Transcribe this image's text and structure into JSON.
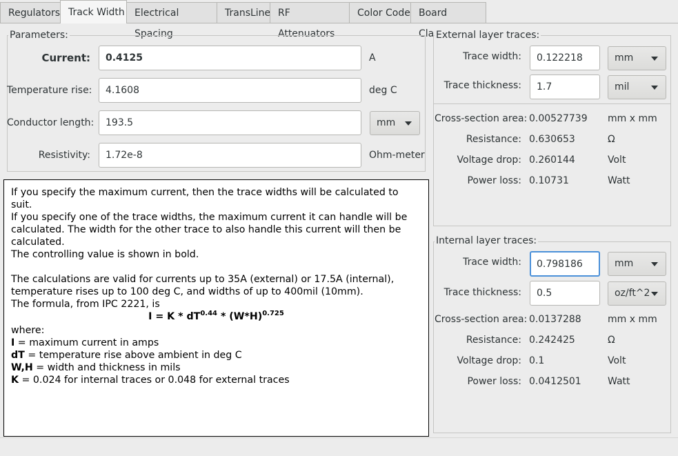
{
  "tabs": [
    "Regulators",
    "Track Width",
    "Electrical Spacing",
    "TransLine",
    "RF Attenuators",
    "Color Code",
    "Board Classes"
  ],
  "parameters": {
    "title": "Parameters:",
    "current": {
      "label": "Current:",
      "value": "0.4125",
      "unit": "A"
    },
    "temperature_rise": {
      "label": "Temperature rise:",
      "value": "4.1608",
      "unit": "deg C"
    },
    "conductor_length": {
      "label": "Conductor length:",
      "value": "193.5",
      "unit": "mm"
    },
    "resistivity": {
      "label": "Resistivity:",
      "value": "1.72e-8",
      "unit": "Ohm-meter"
    }
  },
  "info": {
    "p1": "If you specify the maximum current, then the trace widths will be calculated to suit.",
    "p2": "If you specify one of the trace widths, the maximum current it can handle will be calculated. The width for the other trace to also handle this current will then be calculated.",
    "p3": "The controlling value is shown in bold.",
    "p4": "The calculations are valid for currents up to 35A (external) or 17.5A (internal), temperature rises up to 100 deg C, and widths of up to 400mil (10mm).",
    "p5": "The formula, from IPC 2221, is",
    "formula_base": "I = K * dT",
    "formula_exp1": "0.44",
    "formula_mid": " * (W*H)",
    "formula_exp2": "0.725",
    "where": "where:",
    "defs": [
      {
        "sym": "I",
        "text": " = maximum current in amps"
      },
      {
        "sym": "dT",
        "text": " = temperature rise above ambient in deg C"
      },
      {
        "sym": "W,H",
        "text": " = width and thickness in mils"
      },
      {
        "sym": "K",
        "text": " = 0.024 for internal traces or 0.048 for external traces"
      }
    ]
  },
  "external": {
    "title": "External layer traces:",
    "trace_width": {
      "label": "Trace width:",
      "value": "0.122218",
      "unit": "mm"
    },
    "trace_thickness": {
      "label": "Trace thickness:",
      "value": "1.7",
      "unit": "mil"
    },
    "cross_section": {
      "label": "Cross-section area:",
      "value": "0.00527739",
      "unit": "mm x mm"
    },
    "resistance": {
      "label": "Resistance:",
      "value": "0.630653",
      "unit": "Ω"
    },
    "voltage_drop": {
      "label": "Voltage drop:",
      "value": "0.260144",
      "unit": "Volt"
    },
    "power_loss": {
      "label": "Power loss:",
      "value": "0.10731",
      "unit": "Watt"
    }
  },
  "internal": {
    "title": "Internal layer traces:",
    "trace_width": {
      "label": "Trace width:",
      "value": "0.798186",
      "unit": "mm"
    },
    "trace_thickness": {
      "label": "Trace thickness:",
      "value": "0.5",
      "unit": "oz/ft^2"
    },
    "cross_section": {
      "label": "Cross-section area:",
      "value": "0.0137288",
      "unit": "mm x mm"
    },
    "resistance": {
      "label": "Resistance:",
      "value": "0.242425",
      "unit": "Ω"
    },
    "voltage_drop": {
      "label": "Voltage drop:",
      "value": "0.1",
      "unit": "Volt"
    },
    "power_loss": {
      "label": "Power loss:",
      "value": "0.0412501",
      "unit": "Watt"
    }
  }
}
